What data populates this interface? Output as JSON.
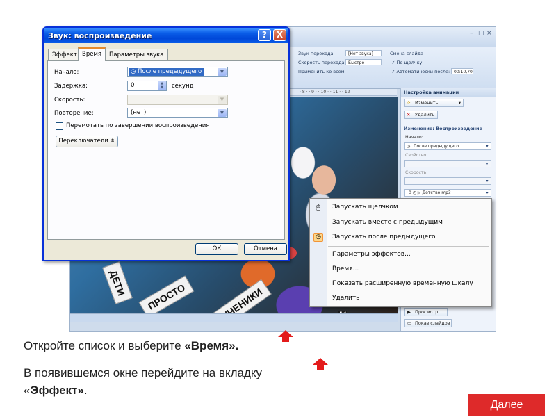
{
  "ppt": {
    "ribbon": {
      "transition_sound_label": "Звук перехода:",
      "transition_sound_value": "[Нет звука]",
      "transition_speed_label": "Скорость перехода:",
      "transition_speed_value": "Быстро",
      "apply_all": "Применить ко всем",
      "slide_change_label": "Смена слайда",
      "on_click": "По щелчку",
      "auto_after": "Автоматически после:",
      "auto_after_value": "00:10,70"
    },
    "ruler_text": "· 8 · · 9 · · 10 · · 11 · · 12 ·",
    "slide_signs": [
      "ДЕТИ",
      "ПРОСТО",
      "УЧЕНИКИ"
    ],
    "animation_pane": {
      "title": "Настройка анимации",
      "change_button": "Изменить",
      "delete_button": "Удалить",
      "change_heading": "Изменение: Воспроизведение",
      "start_label": "Начало:",
      "start_value": "После предыдущего",
      "property_label": "Свойство:",
      "speed_label": "Скорость:",
      "item_index": "0",
      "item_name": "Детство.mp3",
      "preview_button": "Просмотр",
      "slideshow_button": "Показ слайдов"
    }
  },
  "dialog": {
    "title": "Звук: воспроизведение",
    "help_glyph": "?",
    "close_glyph": "X",
    "tabs": [
      {
        "label": "Эффект"
      },
      {
        "label": "Время"
      },
      {
        "label": "Параметры звука"
      }
    ],
    "start_label": "Начало:",
    "start_value": "После предыдущего",
    "delay_label": "Задержка:",
    "delay_value": "0",
    "delay_unit": "секунд",
    "speed_label": "Скорость:",
    "repeat_label": "Повторение:",
    "repeat_value": "(нет)",
    "rewind_label": "Перемотать по завершении воспроизведения",
    "triggers_button": "Переключатели",
    "ok_button": "ОК",
    "cancel_button": "Отмена"
  },
  "context_menu": {
    "items": [
      {
        "label": "Запускать щелчком",
        "icon": "mouse-click-icon"
      },
      {
        "label": "Запускать вместе с предыдущим",
        "icon": ""
      },
      {
        "label": "Запускать после предыдущего",
        "icon": "clock-icon"
      },
      {
        "label": "Параметры эффектов...",
        "icon": ""
      },
      {
        "label": "Время...",
        "icon": ""
      },
      {
        "label": "Показать расширенную временную шкалу",
        "icon": ""
      },
      {
        "label": "Удалить",
        "icon": ""
      }
    ]
  },
  "instructions": {
    "line1_prefix": "Откройте список и выберите ",
    "line1_bold": "«Время».",
    "line2_prefix": "В появившемся окне перейдите на вкладку «",
    "line2_bold": "Эффект»",
    "line2_suffix": "."
  },
  "next_button": "Далее",
  "colors": {
    "arrow": "#e31b1b",
    "next_button_bg": "#de2a2a",
    "dialog_titlebar": "#0a5de8"
  }
}
